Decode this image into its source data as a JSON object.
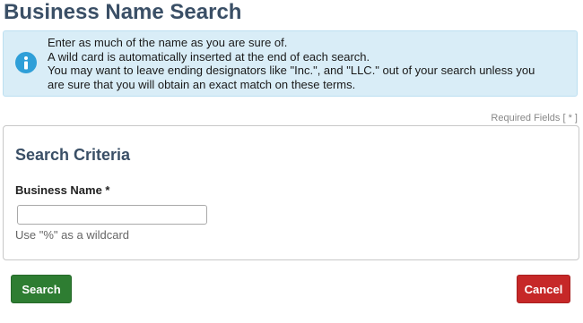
{
  "page": {
    "title": "Business Name Search"
  },
  "info": {
    "icon": "info-icon",
    "lines": [
      "Enter as much of the name as you are sure of.",
      "A wild card is automatically inserted at the end of each search.",
      "You may want to leave ending designators like \"Inc.\", and \"LLC.\" out of your search unless you",
      "are sure that you will obtain an exact match on these terms."
    ]
  },
  "required_note": "Required Fields [ * ]",
  "criteria": {
    "heading": "Search Criteria",
    "business_name": {
      "label": "Business Name *",
      "value": "",
      "help": "Use \"%\" as a wildcard"
    }
  },
  "actions": {
    "search_label": "Search",
    "cancel_label": "Cancel"
  },
  "colors": {
    "title": "#3a4f66",
    "info_bg": "#d9edf7",
    "info_icon": "#2f9fd8",
    "search_button": "#2e7d32",
    "cancel_button": "#c62828"
  }
}
